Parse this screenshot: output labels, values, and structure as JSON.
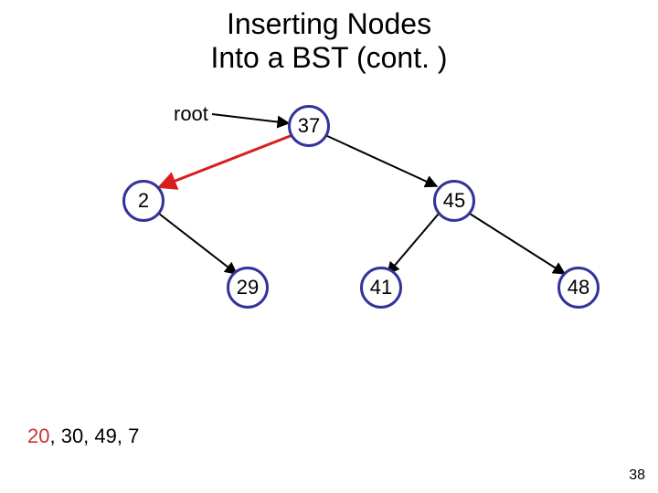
{
  "title_line1": "Inserting Nodes",
  "title_line2": "Into a BST (cont. )",
  "root_label": "root",
  "nodes": {
    "n37": "37",
    "n2": "2",
    "n45": "45",
    "n29": "29",
    "n41": "41",
    "n48": "48"
  },
  "queue": {
    "highlighted": "20",
    "rest": ", 30, 49, 7"
  },
  "page_number": "38",
  "chart_data": {
    "type": "tree",
    "title": "Inserting Nodes Into a BST (cont.)",
    "root_pointer": "root -> 37",
    "active_traversal_edge": [
      "37",
      "2"
    ],
    "nodes": [
      {
        "id": "37",
        "value": 37,
        "left": "2",
        "right": "45"
      },
      {
        "id": "2",
        "value": 2,
        "left": null,
        "right": "29"
      },
      {
        "id": "45",
        "value": 45,
        "left": "41",
        "right": "48"
      },
      {
        "id": "29",
        "value": 29,
        "left": null,
        "right": null
      },
      {
        "id": "41",
        "value": 41,
        "left": null,
        "right": null
      },
      {
        "id": "48",
        "value": 48,
        "left": null,
        "right": null
      }
    ],
    "pending_insertions": [
      20,
      30,
      49,
      7
    ],
    "current_insertion": 20,
    "page_number": 38
  }
}
